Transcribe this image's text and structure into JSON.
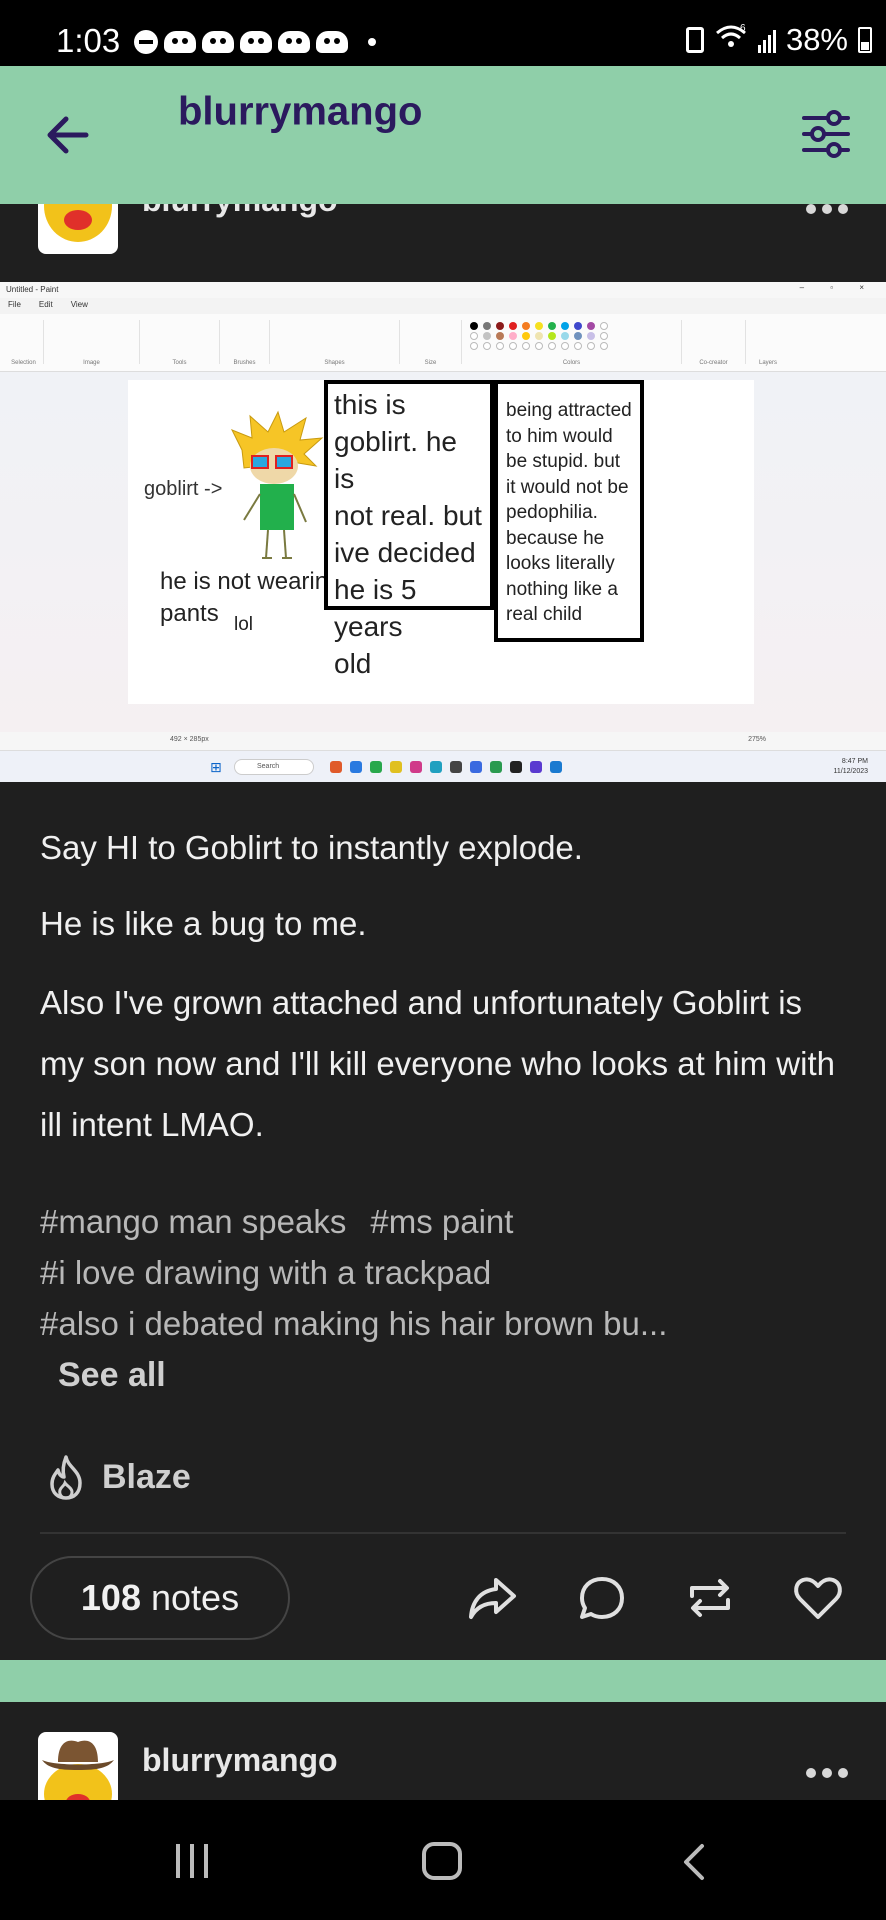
{
  "status_bar": {
    "time": "1:03",
    "battery": "38%",
    "network": "6"
  },
  "header": {
    "title": "blurrymango"
  },
  "post": {
    "author": "blurrymango",
    "image": {
      "app_title": "Untitled - Paint",
      "menu": [
        "File",
        "Edit",
        "View"
      ],
      "ribbon_groups": [
        "Selection",
        "Image",
        "Tools",
        "Brushes",
        "Shapes",
        "Size",
        "Colors",
        "Co-creator",
        "Layers"
      ],
      "canvas_size": "492 × 285px",
      "zoom": "275%",
      "search": "Search",
      "clock_time": "8:47 PM",
      "clock_date": "11/12/2023",
      "drawing": {
        "label": "goblirt ->",
        "pants_line1": "he is not wearing",
        "pants_line2": "pants",
        "lol": "lol",
        "box1_lines": [
          "this is",
          "goblirt. he is",
          "not real. but",
          "ive decided",
          "he is 5 years",
          "old"
        ],
        "box2_lines": [
          "being attracted",
          "to him would",
          "be stupid. but",
          "it would not be",
          "pedophilia.",
          "because he",
          "looks literally",
          "nothing like a",
          "real child"
        ]
      }
    },
    "body": {
      "p1": "Say HI to Goblirt to instantly explode.",
      "p2": "He is like a bug to me.",
      "p3": "Also I've grown attached and unfortunately Goblirt is my son now and I'll kill everyone who looks at him with ill intent LMAO."
    },
    "tags": [
      "#mango man speaks",
      "#ms paint",
      "#i love drawing with a trackpad",
      "#also i debated making his hair brown bu..."
    ],
    "see_all": "See all",
    "blaze": "Blaze",
    "notes_count": "108",
    "notes_label": "notes"
  },
  "next_post": {
    "author": "blurrymango"
  },
  "colors": {
    "header_bg": "#8fcfa9",
    "title": "#2b1a5e",
    "post_bg": "#1f1f1f"
  }
}
